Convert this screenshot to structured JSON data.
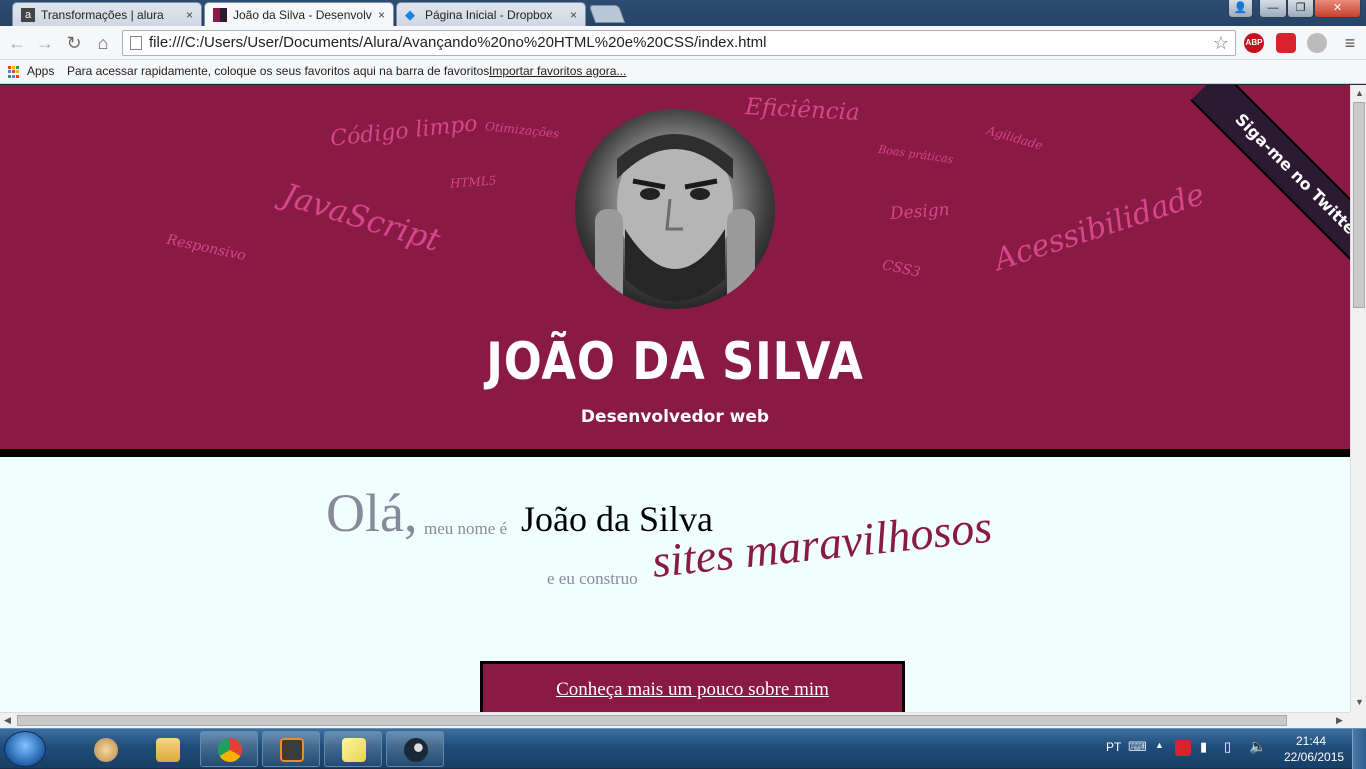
{
  "browser": {
    "tabs": [
      {
        "label": "Transformações | alura",
        "icon": "alura-icon"
      },
      {
        "label": "João da Silva - Desenvolvedor web",
        "icon": "site-icon"
      },
      {
        "label": "Página Inicial - Dropbox",
        "icon": "dropbox-icon"
      }
    ],
    "tab_close": "×",
    "window_buttons": {
      "min": "—",
      "max": "❐",
      "close": "✕",
      "user": "👤"
    },
    "url": "file:///C:/Users/User/Documents/Alura/Avançando%20no%20HTML%20e%20CSS/index.html",
    "nav": {
      "back": "←",
      "forward": "→",
      "reload": "↻",
      "home": "⌂",
      "star": "☆",
      "menu": "≡"
    },
    "extensions": {
      "abp": "ABP"
    },
    "bookmarks": {
      "apps_label": "Apps",
      "hint": "Para acessar rapidamente, coloque os seus favoritos aqui na barra de favoritos.",
      "import_link": "Importar favoritos agora..."
    }
  },
  "page": {
    "hero": {
      "name": "JOÃO DA SILVA",
      "role": "Desenvolvedor web",
      "ribbon": "Siga-me no Twitter",
      "bg_color": "#891a44",
      "word_color": "#d6468a",
      "words": {
        "codigo": "Código limpo",
        "otimizacoes": "Otimizações",
        "eficiencia": "Eficiência",
        "boas": "Boas práticas",
        "agilidade": "Agilidade",
        "javascript": "JavaScript",
        "html5": "HTML5",
        "design": "Design",
        "acessibilidade": "Acessibilidade",
        "responsivo": "Responsivo",
        "css3": "CSS3"
      }
    },
    "intro": {
      "ola": "Olá,",
      "meu_nome": "meu nome é",
      "nome": "João da Silva",
      "construo": "e eu construo",
      "sites": "sites maravilhosos"
    },
    "about_button": "Conheça mais um pouco sobre mim"
  },
  "taskbar": {
    "language": "PT",
    "time": "21:44",
    "date": "22/06/2015",
    "apps": [
      "avatar-app",
      "explorer",
      "chrome",
      "sublime-text",
      "sticky-notes",
      "steam"
    ]
  }
}
